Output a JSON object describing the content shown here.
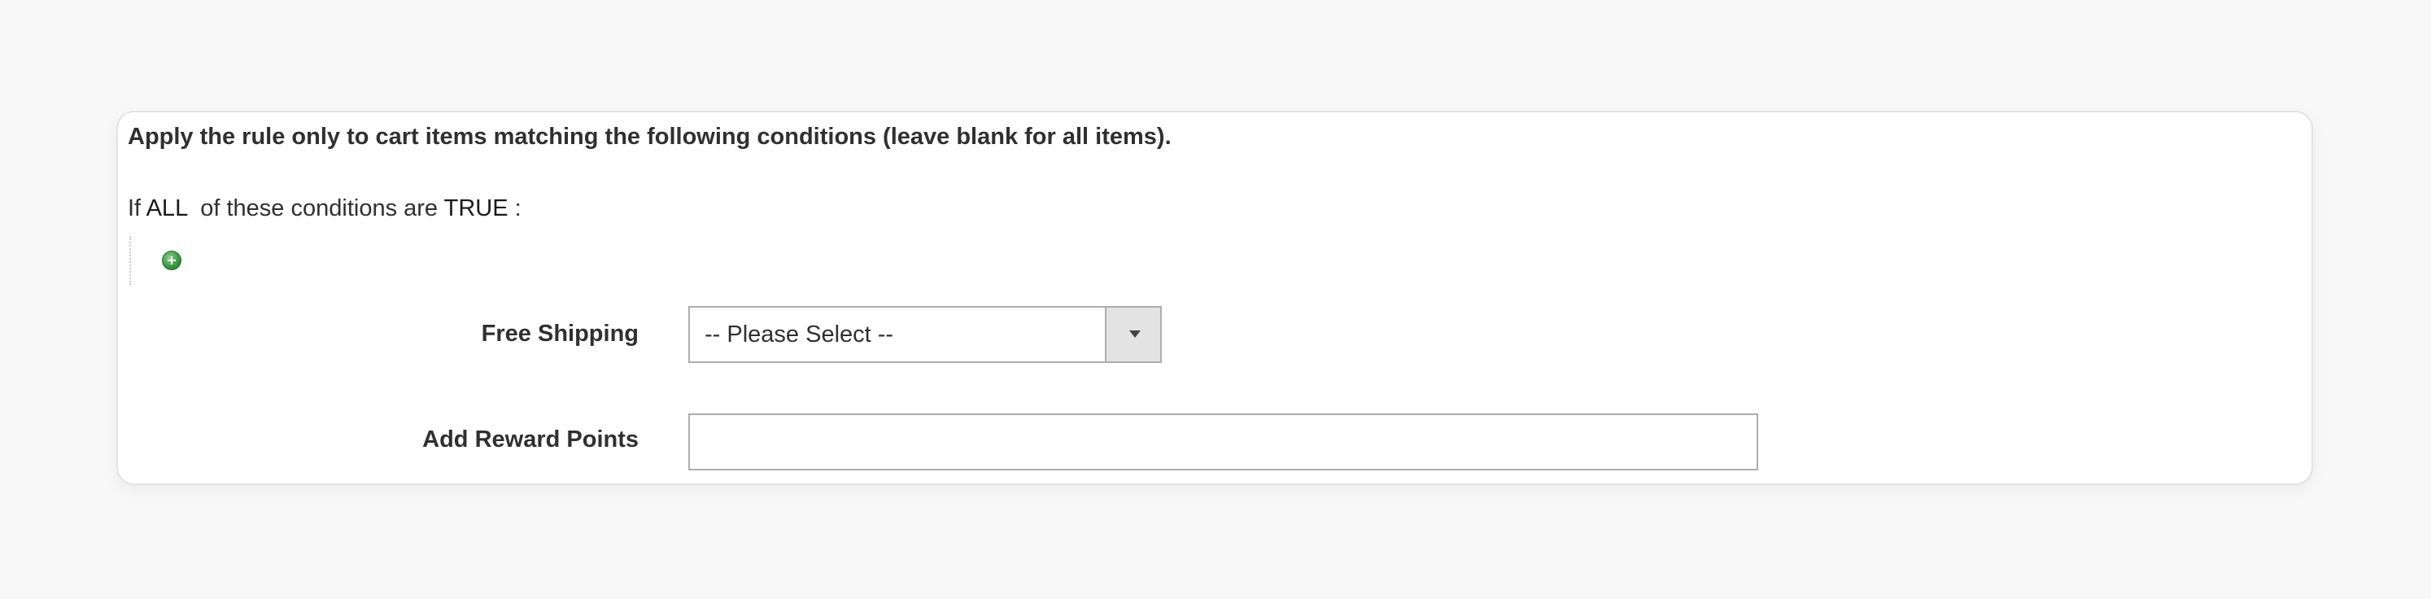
{
  "conditions": {
    "intro_text": "Apply the rule only to cart items matching the following conditions (leave blank for all items).",
    "prefix": "If",
    "aggregator": "ALL",
    "middle": "of these conditions are",
    "value": "TRUE",
    "suffix": ":",
    "add_icon": "add-circle-icon"
  },
  "form": {
    "free_shipping": {
      "label": "Free Shipping",
      "selected": "-- Please Select --",
      "arrow_icon": "caret-down-icon"
    },
    "reward_points": {
      "label": "Add Reward Points",
      "value": "",
      "placeholder": ""
    }
  },
  "colors": {
    "page_bg": "#f8f8f8",
    "panel_bg": "#ffffff",
    "text": "#303030",
    "add_icon": "#3a9a45"
  }
}
